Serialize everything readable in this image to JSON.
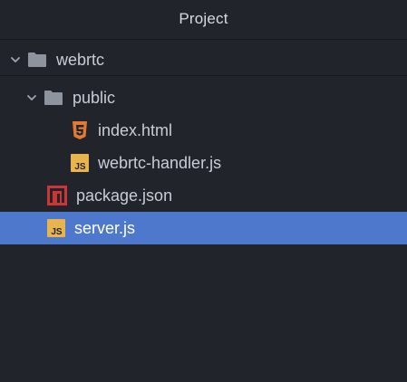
{
  "panel": {
    "title": "Project"
  },
  "tree": {
    "root": {
      "label": "webrtc",
      "expanded": true,
      "icon": "folder-icon"
    },
    "public_folder": {
      "label": "public",
      "expanded": true,
      "icon": "folder-icon"
    },
    "files": {
      "index_html": {
        "label": "index.html",
        "icon": "html5-icon"
      },
      "webrtc_handler": {
        "label": "webrtc-handler.js",
        "icon": "js-icon"
      },
      "package_json": {
        "label": "package.json",
        "icon": "npm-icon"
      },
      "server_js": {
        "label": "server.js",
        "icon": "js-icon",
        "selected": true
      }
    }
  },
  "colors": {
    "background": "#21252b",
    "selection": "#4d78cc",
    "folder": "#8d949e",
    "html5": "#e37933",
    "js": "#e8b44e",
    "npm": "#cc3534"
  }
}
